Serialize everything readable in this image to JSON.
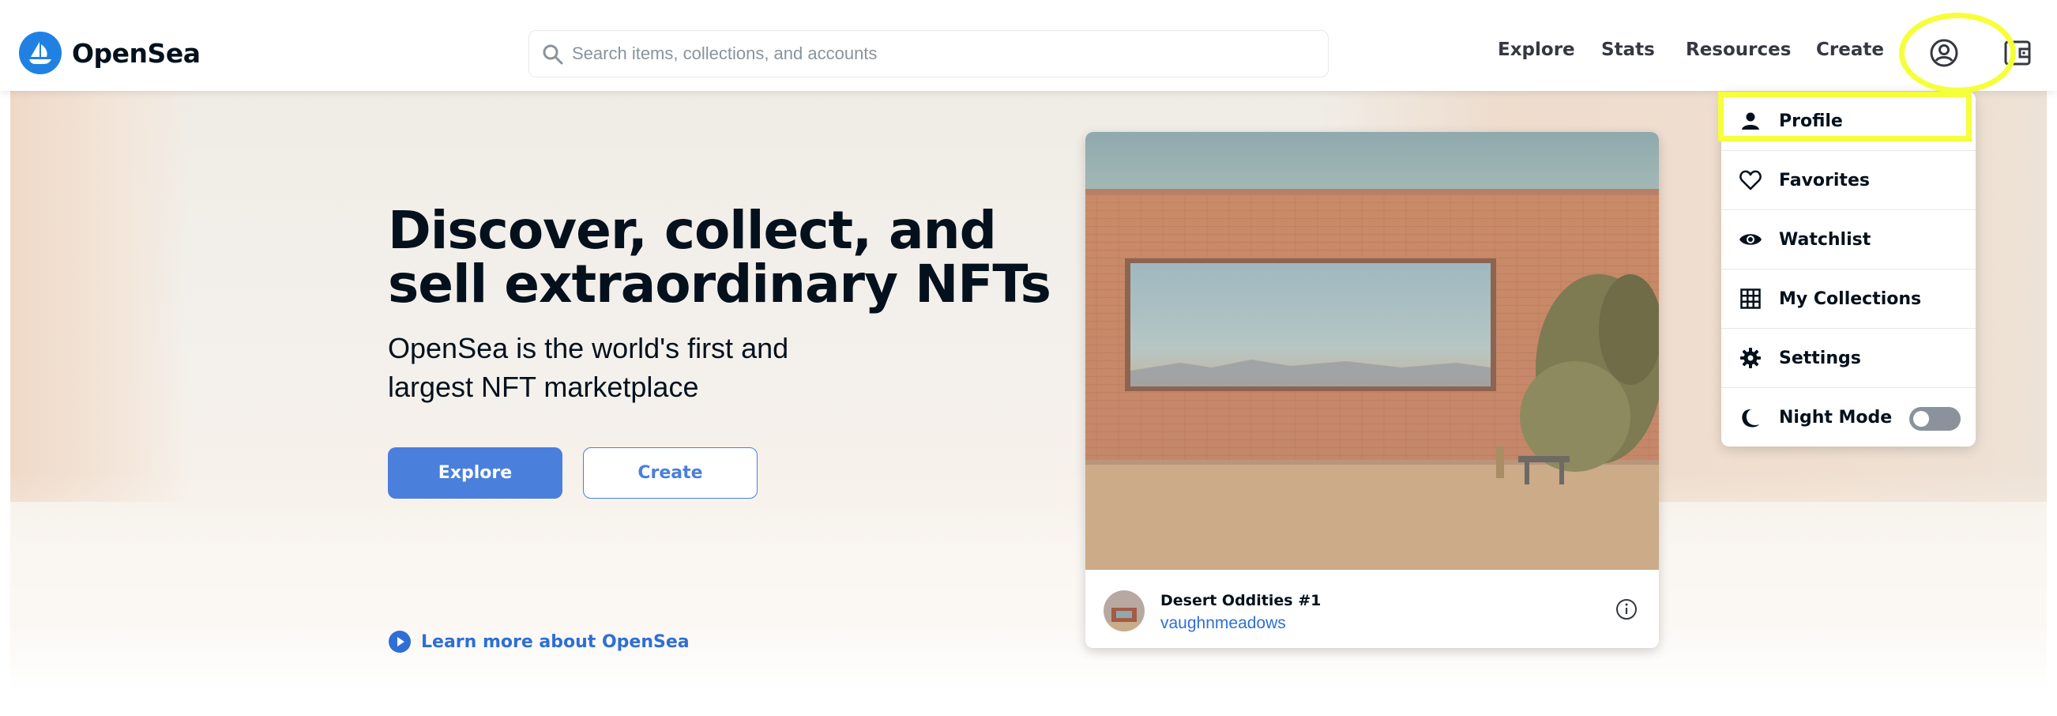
{
  "header": {
    "brand": "OpenSea",
    "search_placeholder": "Search items, collections, and accounts",
    "nav": [
      "Explore",
      "Stats",
      "Resources",
      "Create"
    ]
  },
  "hero": {
    "headline": "Discover, collect, and sell extraordinary NFTs",
    "subline": "OpenSea is the world's first and largest NFT marketplace",
    "explore_label": "Explore",
    "create_label": "Create",
    "learn_more": "Learn more about OpenSea"
  },
  "featured": {
    "title": "Desert Oddities #1",
    "creator": "vaughnmeadows"
  },
  "account_menu": {
    "items": [
      {
        "label": "Profile",
        "icon": "person-icon"
      },
      {
        "label": "Favorites",
        "icon": "heart-icon"
      },
      {
        "label": "Watchlist",
        "icon": "eye-icon"
      },
      {
        "label": "My Collections",
        "icon": "grid-icon"
      },
      {
        "label": "Settings",
        "icon": "gear-icon"
      },
      {
        "label": "Night Mode",
        "icon": "moon-icon",
        "toggle": false
      }
    ]
  },
  "colors": {
    "accent": "#2081e2",
    "button": "#4a7fdc",
    "highlight": "#f5ff3a",
    "text": "#04111d"
  }
}
